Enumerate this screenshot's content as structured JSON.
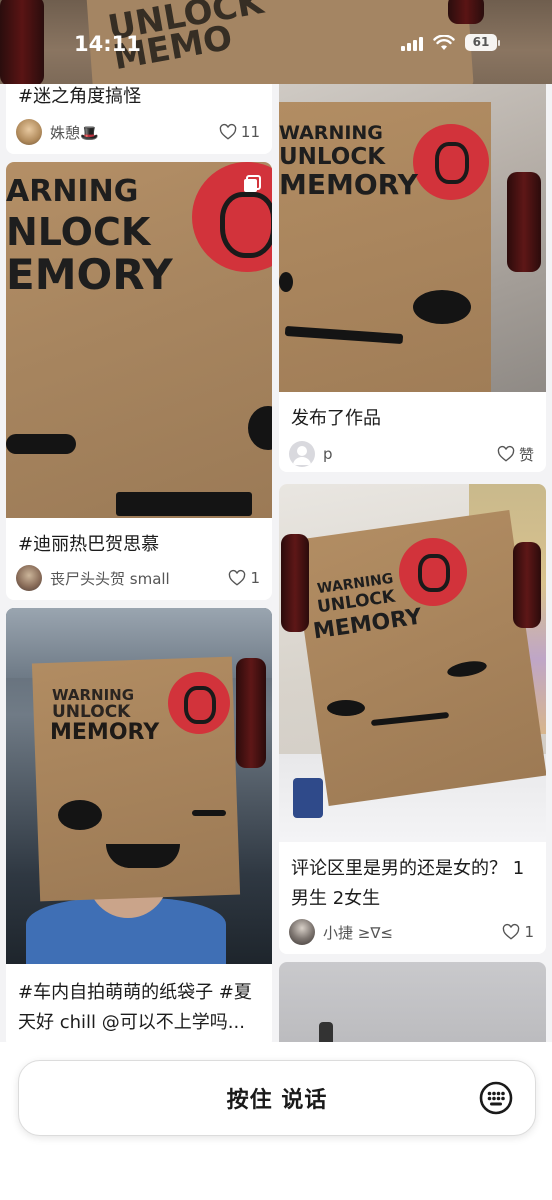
{
  "status_bar": {
    "time": "14:11",
    "battery": "61"
  },
  "feed": {
    "left": [
      {
        "title": "#迷之角度搞怪",
        "author": "姝憩🎩",
        "likes": "11"
      },
      {
        "image_text": [
          "ARNING",
          "NLOCK",
          "EMORY"
        ],
        "title": "#迪丽热巴贺思慕",
        "author": "丧尸头头贺 small",
        "likes": "1"
      },
      {
        "image_text": [
          "WARNING",
          "UNLOCK",
          "MEMORY"
        ],
        "title_line1": "#车内自拍萌萌的纸袋子 #夏",
        "title_line2": "天好 chill  @可以不上学吗..."
      }
    ],
    "right": [
      {
        "image_text": [
          "WARNING",
          "UNLOCK",
          "MEMORY"
        ],
        "title": "发布了作品",
        "author": "p",
        "likes": "赞"
      },
      {
        "image_text": [
          "WARNING",
          "UNLOCK",
          "MEMORY"
        ],
        "title_line1": "评论区里是男的还是女的？ 1",
        "title_line2": "男生      2女生",
        "author": "小捷 ≥∇≤",
        "likes": "1"
      }
    ]
  },
  "bottom_bar": {
    "voice_label": "按住 说话",
    "keyboard_icon": "keyboard-icon"
  },
  "colors": {
    "bag": "#a7855f",
    "bag_dark": "#8c6c4b",
    "logo_red": "#d2333b",
    "background": "#f3f3f5"
  }
}
